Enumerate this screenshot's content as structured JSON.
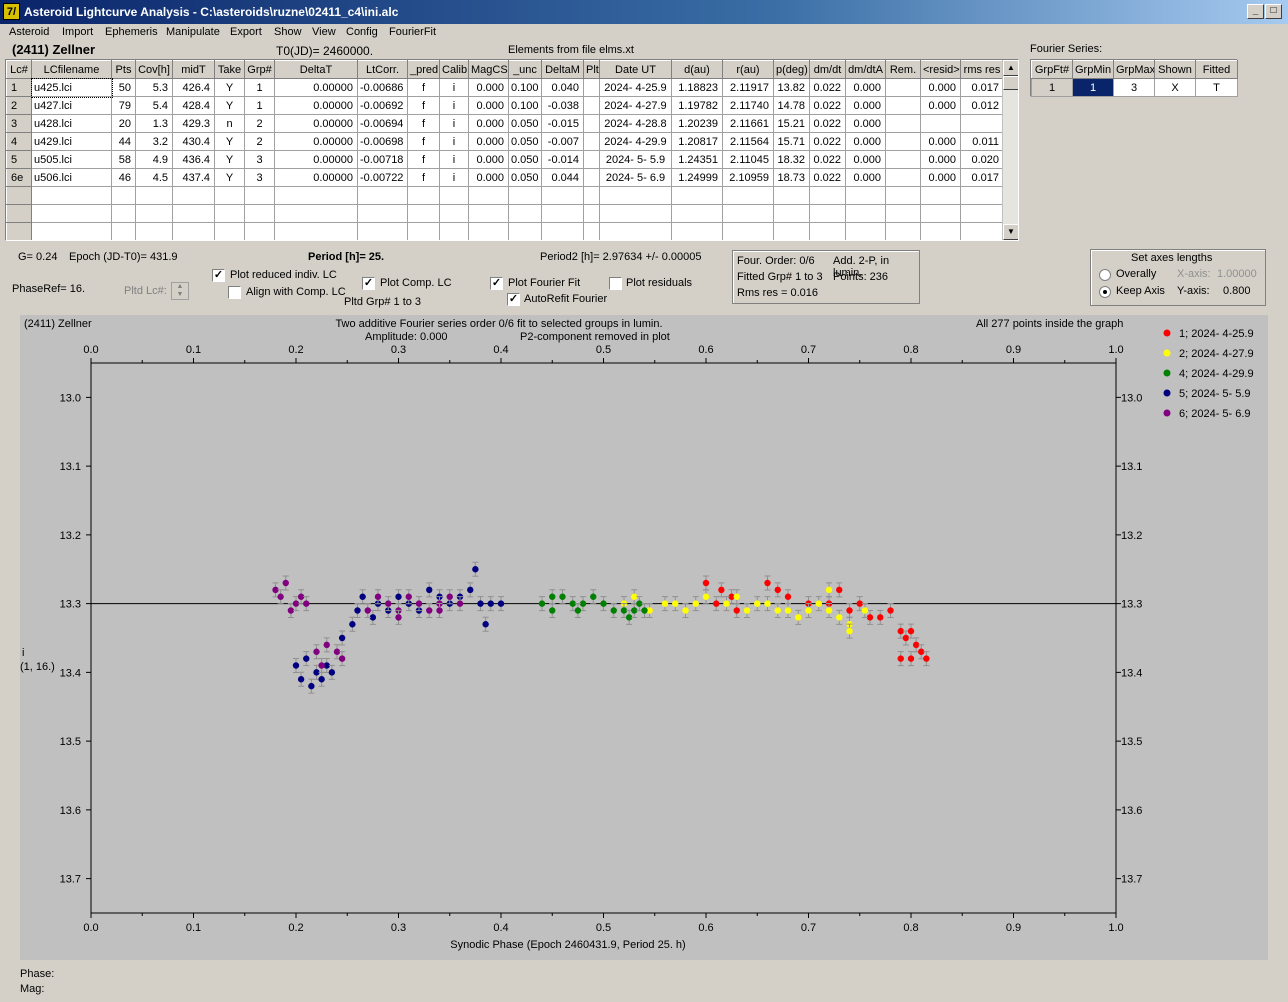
{
  "window": {
    "app_icon": "7/",
    "title": "Asteroid Lightcurve Analysis - C:\\asteroids\\ruzne\\02411_c4\\ini.alc",
    "controls": [
      "_",
      "□",
      "X"
    ]
  },
  "menu": [
    "Asteroid",
    "Import",
    "Ephemeris",
    "Manipulate",
    "Export",
    "Show",
    "View",
    "Config",
    "FourierFit"
  ],
  "header": {
    "asteroid": "(2411) Zellner",
    "t0": "T0(JD)= 2460000.",
    "elements": "Elements from file elms.xt"
  },
  "lc_table": {
    "columns": [
      "Lc#",
      "LCfilename",
      "Pts",
      "Cov[h]",
      "midT",
      "Take",
      "Grp#",
      "DeltaT",
      "LtCorr.",
      "_pred.",
      "Calib.",
      "MagCS",
      "_unc",
      "DeltaM",
      "Plt",
      "Date UT",
      "d(au)",
      "r(au)",
      "p(deg)",
      "dm/dt",
      "dm/dtA",
      "Rem.",
      "<resid>",
      "rms res"
    ],
    "rows": [
      [
        "1",
        "u425.lci",
        "50",
        "5.3",
        "426.4",
        "Y",
        "1",
        "0.00000",
        "-0.00686",
        "f",
        "i",
        "0.000",
        "0.100",
        "0.040",
        "",
        "2024- 4-25.9",
        "1.18823",
        "2.11917",
        "13.82",
        "0.022",
        "0.000",
        "",
        "0.000",
        "0.017"
      ],
      [
        "2",
        "u427.lci",
        "79",
        "5.4",
        "428.4",
        "Y",
        "1",
        "0.00000",
        "-0.00692",
        "f",
        "i",
        "0.000",
        "0.100",
        "-0.038",
        "",
        "2024- 4-27.9",
        "1.19782",
        "2.11740",
        "14.78",
        "0.022",
        "0.000",
        "",
        "0.000",
        "0.012"
      ],
      [
        "3",
        "u428.lci",
        "20",
        "1.3",
        "429.3",
        "n",
        "2",
        "0.00000",
        "-0.00694",
        "f",
        "i",
        "0.000",
        "0.050",
        "-0.015",
        "",
        "2024- 4-28.8",
        "1.20239",
        "2.11661",
        "15.21",
        "0.022",
        "0.000",
        "",
        "",
        ""
      ],
      [
        "4",
        "u429.lci",
        "44",
        "3.2",
        "430.4",
        "Y",
        "2",
        "0.00000",
        "-0.00698",
        "f",
        "i",
        "0.000",
        "0.050",
        "-0.007",
        "",
        "2024- 4-29.9",
        "1.20817",
        "2.11564",
        "15.71",
        "0.022",
        "0.000",
        "",
        "0.000",
        "0.011"
      ],
      [
        "5",
        "u505.lci",
        "58",
        "4.9",
        "436.4",
        "Y",
        "3",
        "0.00000",
        "-0.00718",
        "f",
        "i",
        "0.000",
        "0.050",
        "-0.014",
        "",
        "2024- 5- 5.9",
        "1.24351",
        "2.11045",
        "18.32",
        "0.022",
        "0.000",
        "",
        "0.000",
        "0.020"
      ],
      [
        "6e",
        "u506.lci",
        "46",
        "4.5",
        "437.4",
        "Y",
        "3",
        "0.00000",
        "-0.00722",
        "f",
        "i",
        "0.000",
        "0.050",
        "0.044",
        "",
        "2024- 5- 6.9",
        "1.24999",
        "2.10959",
        "18.73",
        "0.022",
        "0.000",
        "",
        "0.000",
        "0.017"
      ]
    ],
    "empty_rows": 3
  },
  "fourier": {
    "label": "Fourier Series:",
    "columns": [
      "GrpFt#",
      "GrpMin",
      "GrpMax",
      "Shown",
      "Fitted"
    ],
    "row": [
      "1",
      "1",
      "3",
      "X",
      "T"
    ]
  },
  "info": {
    "g": "G= 0.24",
    "epoch": "Epoch (JD-T0)= 431.9",
    "period": "Period [h]= 25.",
    "period2": "Period2 [h]= 2.97634 +/- 0.00005",
    "phaseref": "PhaseRef= 16.",
    "pltd_lc": "Pltd Lc#:",
    "pltd_grp": "Pltd Grp#  1   to   3"
  },
  "checks": {
    "plot_reduced": {
      "label": "Plot reduced indiv. LC",
      "checked": true
    },
    "align_comp": {
      "label": "Align with Comp. LC",
      "checked": false
    },
    "plot_comp": {
      "label": "Plot Comp. LC",
      "checked": true
    },
    "plot_fourier": {
      "label": "Plot Fourier Fit",
      "checked": true
    },
    "autorefit": {
      "label": "AutoRefit Fourier",
      "checked": true
    },
    "plot_residuals": {
      "label": "Plot residuals",
      "checked": false
    }
  },
  "fit_info": {
    "order": "Four. Order:  0/6",
    "add": "Add. 2-P, in lumin.",
    "fitted": "Fitted Grp# 1 to 3",
    "points": "Points: 236",
    "rms": "Rms res     = 0.016"
  },
  "axes_box": {
    "title": "Set axes lengths",
    "overall": "Overally",
    "keep": "Keep Axis",
    "xaxis_label": "X-axis:",
    "xaxis_value": "1.00000",
    "yaxis_label": "Y-axis:",
    "yaxis_value": "0.800",
    "selected": "keep"
  },
  "chart_text": {
    "name": "(2411) Zellner",
    "subtitle1": "Two additive Fourier series order 0/6 fit to selected groups in lumin.",
    "subtitle2": "Amplitude: 0.000",
    "subtitle3": "P2-component removed in plot",
    "status": "All 277 points inside the graph",
    "ylabel1": "i",
    "ylabel2": "(1, 16.)",
    "xlabel": "Synodic Phase (Epoch 2460431.9, Period 25. h)"
  },
  "chart_data": {
    "type": "scatter",
    "xlabel": "Synodic Phase (Epoch 2460431.9, Period 25. h)",
    "ylabel": "i",
    "xlim": [
      0.0,
      1.0
    ],
    "ylim": [
      13.75,
      12.95
    ],
    "y_inverted": true,
    "grid": false,
    "legend_position": "right",
    "x_ticks": [
      "0.0",
      "0.1",
      "0.2",
      "0.3",
      "0.4",
      "0.5",
      "0.6",
      "0.7",
      "0.8",
      "0.9",
      "1.0"
    ],
    "y_ticks": [
      "13.0",
      "13.1",
      "13.2",
      "13.3",
      "13.4",
      "13.5",
      "13.6",
      "13.7"
    ],
    "fit_line": 13.3,
    "series": [
      {
        "name": "1; 2024- 4-25.9",
        "color": "#ff0000",
        "points": [
          [
            0.6,
            13.27
          ],
          [
            0.61,
            13.3
          ],
          [
            0.615,
            13.28
          ],
          [
            0.625,
            13.29
          ],
          [
            0.63,
            13.31
          ],
          [
            0.68,
            13.29
          ],
          [
            0.7,
            13.3
          ],
          [
            0.72,
            13.3
          ],
          [
            0.74,
            13.31
          ],
          [
            0.76,
            13.32
          ],
          [
            0.77,
            13.32
          ],
          [
            0.78,
            13.31
          ],
          [
            0.79,
            13.34
          ],
          [
            0.795,
            13.35
          ],
          [
            0.8,
            13.34
          ],
          [
            0.805,
            13.36
          ],
          [
            0.79,
            13.38
          ],
          [
            0.8,
            13.38
          ],
          [
            0.81,
            13.37
          ],
          [
            0.815,
            13.38
          ],
          [
            0.73,
            13.28
          ],
          [
            0.75,
            13.3
          ],
          [
            0.66,
            13.27
          ],
          [
            0.67,
            13.28
          ]
        ]
      },
      {
        "name": "2; 2024- 4-27.9",
        "color": "#ffff00",
        "points": [
          [
            0.52,
            13.3
          ],
          [
            0.53,
            13.29
          ],
          [
            0.545,
            13.31
          ],
          [
            0.56,
            13.3
          ],
          [
            0.57,
            13.3
          ],
          [
            0.58,
            13.31
          ],
          [
            0.59,
            13.3
          ],
          [
            0.6,
            13.29
          ],
          [
            0.62,
            13.3
          ],
          [
            0.63,
            13.29
          ],
          [
            0.64,
            13.31
          ],
          [
            0.65,
            13.3
          ],
          [
            0.66,
            13.3
          ],
          [
            0.67,
            13.31
          ],
          [
            0.68,
            13.31
          ],
          [
            0.69,
            13.32
          ],
          [
            0.7,
            13.31
          ],
          [
            0.71,
            13.3
          ],
          [
            0.72,
            13.31
          ],
          [
            0.73,
            13.32
          ],
          [
            0.74,
            13.33
          ],
          [
            0.755,
            13.31
          ],
          [
            0.72,
            13.28
          ],
          [
            0.74,
            13.34
          ]
        ]
      },
      {
        "name": "4; 2024- 4-29.9",
        "color": "#008000",
        "points": [
          [
            0.44,
            13.3
          ],
          [
            0.45,
            13.29
          ],
          [
            0.46,
            13.29
          ],
          [
            0.47,
            13.3
          ],
          [
            0.48,
            13.3
          ],
          [
            0.49,
            13.29
          ],
          [
            0.5,
            13.3
          ],
          [
            0.51,
            13.31
          ],
          [
            0.52,
            13.31
          ],
          [
            0.525,
            13.32
          ],
          [
            0.53,
            13.31
          ],
          [
            0.535,
            13.3
          ],
          [
            0.54,
            13.31
          ],
          [
            0.45,
            13.31
          ],
          [
            0.475,
            13.31
          ]
        ]
      },
      {
        "name": "5; 2024- 5- 5.9",
        "color": "#000080",
        "points": [
          [
            0.2,
            13.39
          ],
          [
            0.205,
            13.41
          ],
          [
            0.21,
            13.38
          ],
          [
            0.215,
            13.42
          ],
          [
            0.22,
            13.4
          ],
          [
            0.225,
            13.41
          ],
          [
            0.23,
            13.39
          ],
          [
            0.235,
            13.4
          ],
          [
            0.245,
            13.35
          ],
          [
            0.255,
            13.33
          ],
          [
            0.26,
            13.31
          ],
          [
            0.265,
            13.29
          ],
          [
            0.275,
            13.32
          ],
          [
            0.28,
            13.3
          ],
          [
            0.29,
            13.31
          ],
          [
            0.3,
            13.29
          ],
          [
            0.31,
            13.3
          ],
          [
            0.32,
            13.31
          ],
          [
            0.33,
            13.28
          ],
          [
            0.34,
            13.29
          ],
          [
            0.35,
            13.3
          ],
          [
            0.36,
            13.29
          ],
          [
            0.37,
            13.28
          ],
          [
            0.375,
            13.25
          ],
          [
            0.38,
            13.3
          ],
          [
            0.39,
            13.3
          ],
          [
            0.4,
            13.3
          ],
          [
            0.385,
            13.33
          ]
        ]
      },
      {
        "name": "6; 2024- 5- 6.9",
        "color": "#800080",
        "points": [
          [
            0.18,
            13.28
          ],
          [
            0.185,
            13.29
          ],
          [
            0.19,
            13.27
          ],
          [
            0.195,
            13.31
          ],
          [
            0.2,
            13.3
          ],
          [
            0.205,
            13.29
          ],
          [
            0.21,
            13.3
          ],
          [
            0.22,
            13.37
          ],
          [
            0.225,
            13.39
          ],
          [
            0.23,
            13.36
          ],
          [
            0.24,
            13.37
          ],
          [
            0.245,
            13.38
          ],
          [
            0.27,
            13.31
          ],
          [
            0.28,
            13.29
          ],
          [
            0.29,
            13.3
          ],
          [
            0.3,
            13.31
          ],
          [
            0.31,
            13.29
          ],
          [
            0.32,
            13.3
          ],
          [
            0.33,
            13.31
          ],
          [
            0.34,
            13.3
          ],
          [
            0.35,
            13.29
          ],
          [
            0.36,
            13.3
          ],
          [
            0.3,
            13.32
          ],
          [
            0.34,
            13.31
          ]
        ]
      }
    ]
  },
  "status": {
    "phase": "Phase:",
    "mag": "Mag:"
  },
  "colors": {
    "title_gradient_start": "#0a246a",
    "face": "#d4d0c8",
    "plot_bg": "#c0c0c0",
    "selected_cell": "#0a246a"
  }
}
